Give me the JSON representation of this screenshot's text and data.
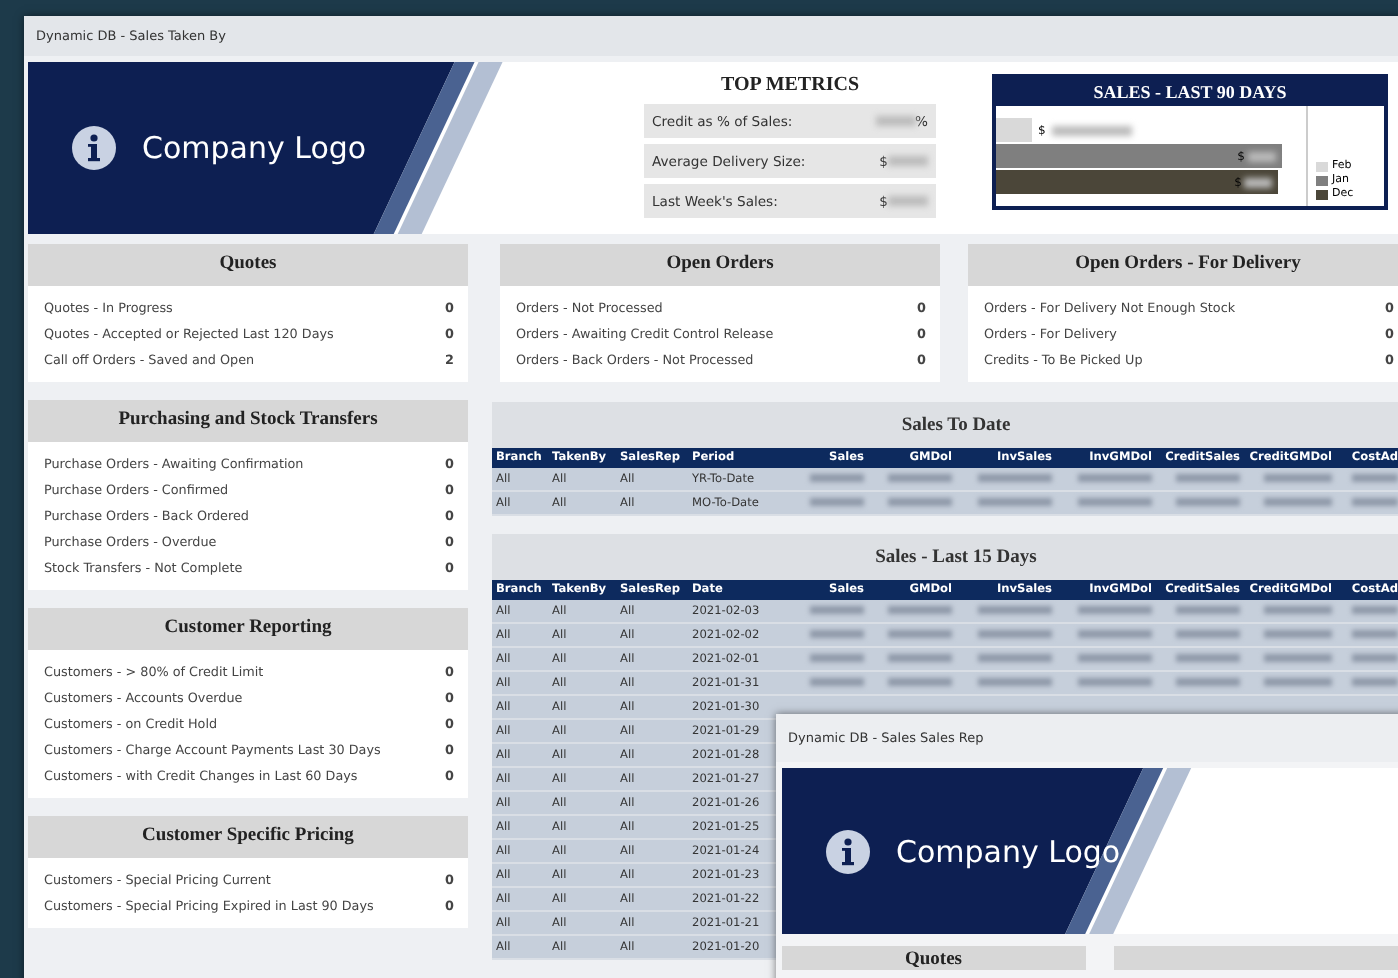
{
  "main_window": {
    "title": "Dynamic DB - Sales Taken By",
    "logo": "Company Logo",
    "top_metrics": {
      "title": "TOP METRICS",
      "items": [
        {
          "label": "Credit as % of Sales:",
          "suffix": "%"
        },
        {
          "label": "Average Delivery Size:",
          "prefix": "$"
        },
        {
          "label": "Last Week's Sales:",
          "prefix": "$"
        }
      ]
    },
    "sales_chart": {
      "title": "SALES - LAST 90 DAYS",
      "bars": [
        {
          "name": "Feb",
          "color": "#d9d9d9",
          "prefix": "$"
        },
        {
          "name": "Jan",
          "color": "#7f7f7f",
          "prefix": "$"
        },
        {
          "name": "Dec",
          "color": "#4b4639",
          "prefix": "$"
        }
      ]
    },
    "left_cards": [
      {
        "title": "Quotes",
        "rows": [
          {
            "label": "Quotes - In Progress",
            "value": "0"
          },
          {
            "label": "Quotes - Accepted or Rejected Last 120 Days",
            "value": "0"
          },
          {
            "label": "Call off Orders - Saved and Open",
            "value": "2"
          }
        ]
      },
      {
        "title": "Purchasing and Stock Transfers",
        "rows": [
          {
            "label": "Purchase Orders - Awaiting Confirmation",
            "value": "0"
          },
          {
            "label": "Purchase Orders - Confirmed",
            "value": "0"
          },
          {
            "label": "Purchase Orders - Back Ordered",
            "value": "0"
          },
          {
            "label": "Purchase Orders - Overdue",
            "value": "0"
          },
          {
            "label": "Stock Transfers - Not Complete",
            "value": "0"
          }
        ]
      },
      {
        "title": "Customer Reporting",
        "rows": [
          {
            "label": "Customers - > 80% of Credit Limit",
            "value": "0"
          },
          {
            "label": "Customers - Accounts Overdue",
            "value": "0"
          },
          {
            "label": "Customers - on Credit Hold",
            "value": "0"
          },
          {
            "label": "Customers - Charge Account Payments Last 30 Days",
            "value": "0"
          },
          {
            "label": "Customers - with Credit Changes in Last 60 Days",
            "value": "0"
          }
        ]
      },
      {
        "title": "Customer Specific Pricing",
        "rows": [
          {
            "label": "Customers - Special Pricing Current",
            "value": "0"
          },
          {
            "label": "Customers - Special Pricing Expired in Last 90 Days",
            "value": "0"
          }
        ]
      }
    ],
    "top_cards": [
      {
        "title": "Open Orders",
        "rows": [
          {
            "label": "Orders - Not Processed",
            "value": "0"
          },
          {
            "label": "Orders - Awaiting Credit Control Release",
            "value": "0"
          },
          {
            "label": "Orders - Back Orders - Not Processed",
            "value": "0"
          }
        ]
      },
      {
        "title": "Open Orders - For Delivery",
        "rows": [
          {
            "label": "Orders - For Delivery Not Enough Stock",
            "value": "0"
          },
          {
            "label": "Orders - For Delivery",
            "value": "0"
          },
          {
            "label": "Credits - To Be Picked Up",
            "value": "0"
          }
        ]
      }
    ],
    "tables": [
      {
        "title": "Sales To Date",
        "columns": [
          "Branch",
          "TakenBy",
          "SalesRep",
          "Period",
          "Sales",
          "GMDol",
          "InvSales",
          "InvGMDol",
          "CreditSales",
          "CreditGMDol",
          "CostAd"
        ],
        "rows": [
          {
            "cells": [
              "All",
              "All",
              "All",
              "YR-To-Date"
            ],
            "redacted": true
          },
          {
            "cells": [
              "All",
              "All",
              "All",
              "MO-To-Date"
            ],
            "redacted": true
          }
        ]
      },
      {
        "title": "Sales - Last 15 Days",
        "columns": [
          "Branch",
          "TakenBy",
          "SalesRep",
          "Date",
          "Sales",
          "GMDol",
          "InvSales",
          "InvGMDol",
          "CreditSales",
          "CreditGMDol",
          "CostAd"
        ],
        "rows": [
          {
            "cells": [
              "All",
              "All",
              "All",
              "2021-02-03"
            ],
            "redacted": true
          },
          {
            "cells": [
              "All",
              "All",
              "All",
              "2021-02-02"
            ],
            "redacted": true
          },
          {
            "cells": [
              "All",
              "All",
              "All",
              "2021-02-01"
            ],
            "redacted": true
          },
          {
            "cells": [
              "All",
              "All",
              "All",
              "2021-01-31"
            ],
            "redacted": true
          },
          {
            "cells": [
              "All",
              "All",
              "All",
              "2021-01-30"
            ]
          },
          {
            "cells": [
              "All",
              "All",
              "All",
              "2021-01-29"
            ]
          },
          {
            "cells": [
              "All",
              "All",
              "All",
              "2021-01-28"
            ]
          },
          {
            "cells": [
              "All",
              "All",
              "All",
              "2021-01-27"
            ]
          },
          {
            "cells": [
              "All",
              "All",
              "All",
              "2021-01-26"
            ]
          },
          {
            "cells": [
              "All",
              "All",
              "All",
              "2021-01-25"
            ]
          },
          {
            "cells": [
              "All",
              "All",
              "All",
              "2021-01-24"
            ]
          },
          {
            "cells": [
              "All",
              "All",
              "All",
              "2021-01-23"
            ]
          },
          {
            "cells": [
              "All",
              "All",
              "All",
              "2021-01-22"
            ]
          },
          {
            "cells": [
              "All",
              "All",
              "All",
              "2021-01-21"
            ]
          },
          {
            "cells": [
              "All",
              "All",
              "All",
              "2021-01-20"
            ]
          }
        ]
      }
    ]
  },
  "overlay_window": {
    "title": "Dynamic DB - Sales Sales Rep",
    "logo": "Company Logo",
    "cards": [
      {
        "kind": "titled",
        "title": "Quotes"
      },
      {
        "kind": "blank"
      }
    ]
  }
}
